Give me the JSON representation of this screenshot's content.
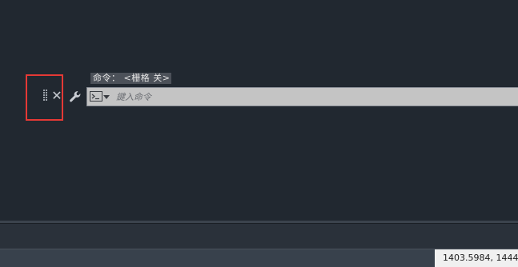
{
  "command_line": {
    "history_text": "命令：  <栅格 关>",
    "input_placeholder": "鍵入命令",
    "input_value": ""
  },
  "status_bar": {
    "coordinates": "1403.5984, 1444."
  },
  "icons": {
    "grip": "grip-handle-icon",
    "close": "close-icon",
    "customize": "wrench-icon",
    "prompt": "command-prompt-icon",
    "recent": "chevron-down-icon",
    "scroll": "chevron-up-icon"
  },
  "colors": {
    "canvas_background": "#212830",
    "highlight": "#e53935",
    "input_background": "#c4c4c4"
  }
}
